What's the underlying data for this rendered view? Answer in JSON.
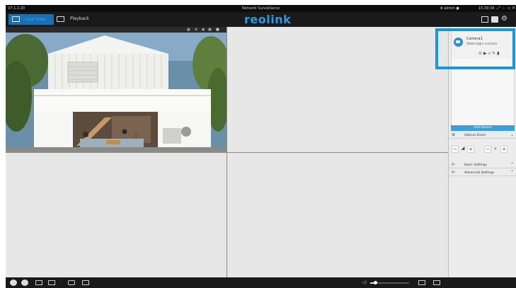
{
  "titlebar": {
    "version": "V7.1.2.20",
    "title": "Network Surveillance",
    "user": "admin",
    "clock": "15:39:34"
  },
  "toolbar": {
    "live_label": "Live View",
    "playback_label": "Playback",
    "brand": "reolink"
  },
  "device": {
    "name": "Camera1",
    "status": "State:login success"
  },
  "panel": {
    "add_device": "Add Device",
    "optical_zoom": "Optical Zoom",
    "basic_settings": "Basic Settings",
    "advanced_settings": "Advanced Settings"
  },
  "volume": {
    "level": 0.12
  },
  "colors": {
    "accent": "#1a97d8",
    "bar": "#1a1a1a",
    "stage": "#e7e7e7"
  }
}
